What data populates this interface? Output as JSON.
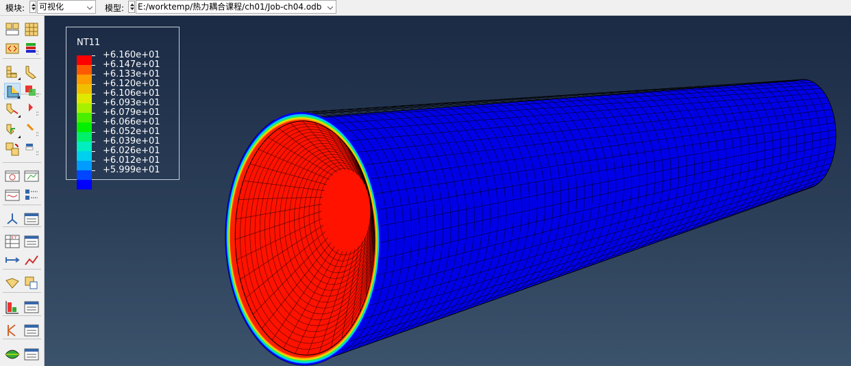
{
  "context_bar": {
    "module_label": "模块:",
    "module_value": "可视化",
    "model_label": "模型:",
    "model_value": "E:/worktemp/热力耦合课程/ch01/Job-ch04.odb"
  },
  "toolbox": {
    "icons": [
      "numbering-icon",
      "grid-layout-icon",
      "probe-arrows-icon",
      "layer-stack-icon",
      "undeformed-shape-icon",
      "deformed-shape-icon",
      "contour-plot-icon",
      "contour-options-icon",
      "symbol-plot-icon",
      "symbol-options-icon",
      "material-orientation-icon",
      "orientation-options-icon",
      "swap-results-icon",
      "results-options-icon",
      "animate-scale-icon",
      "animate-time-icon",
      "animate-history-icon",
      "animation-options-icon",
      "view-cut-icon",
      "view-cut-manager-icon",
      "xy-data-icon",
      "xy-data-manager-icon",
      "path-icon",
      "path-chart-icon",
      "free-body-icon",
      "free-body-manager-icon",
      "report-field-icon",
      "report-manager-icon",
      "stream-icon",
      "stream-manager-icon",
      "display-group-icon",
      "display-group-manager-icon"
    ]
  },
  "legend": {
    "title": "NT11",
    "colors": [
      "#ff0000",
      "#ff5a00",
      "#ff9c00",
      "#f0c000",
      "#e0e800",
      "#a6f000",
      "#4aef00",
      "#00f000",
      "#00f06a",
      "#00eec0",
      "#00d0f0",
      "#009cff",
      "#0046ff",
      "#0000ff"
    ],
    "values": [
      "+6.160e+01",
      "+6.147e+01",
      "+6.133e+01",
      "+6.120e+01",
      "+6.106e+01",
      "+6.093e+01",
      "+6.079e+01",
      "+6.066e+01",
      "+6.052e+01",
      "+6.039e+01",
      "+6.026e+01",
      "+6.012e+01",
      "+5.999e+01"
    ]
  },
  "model_view": {
    "outer_color": "#0000e6",
    "inner_color": "#ff1200",
    "mesh_color": "#000000"
  }
}
